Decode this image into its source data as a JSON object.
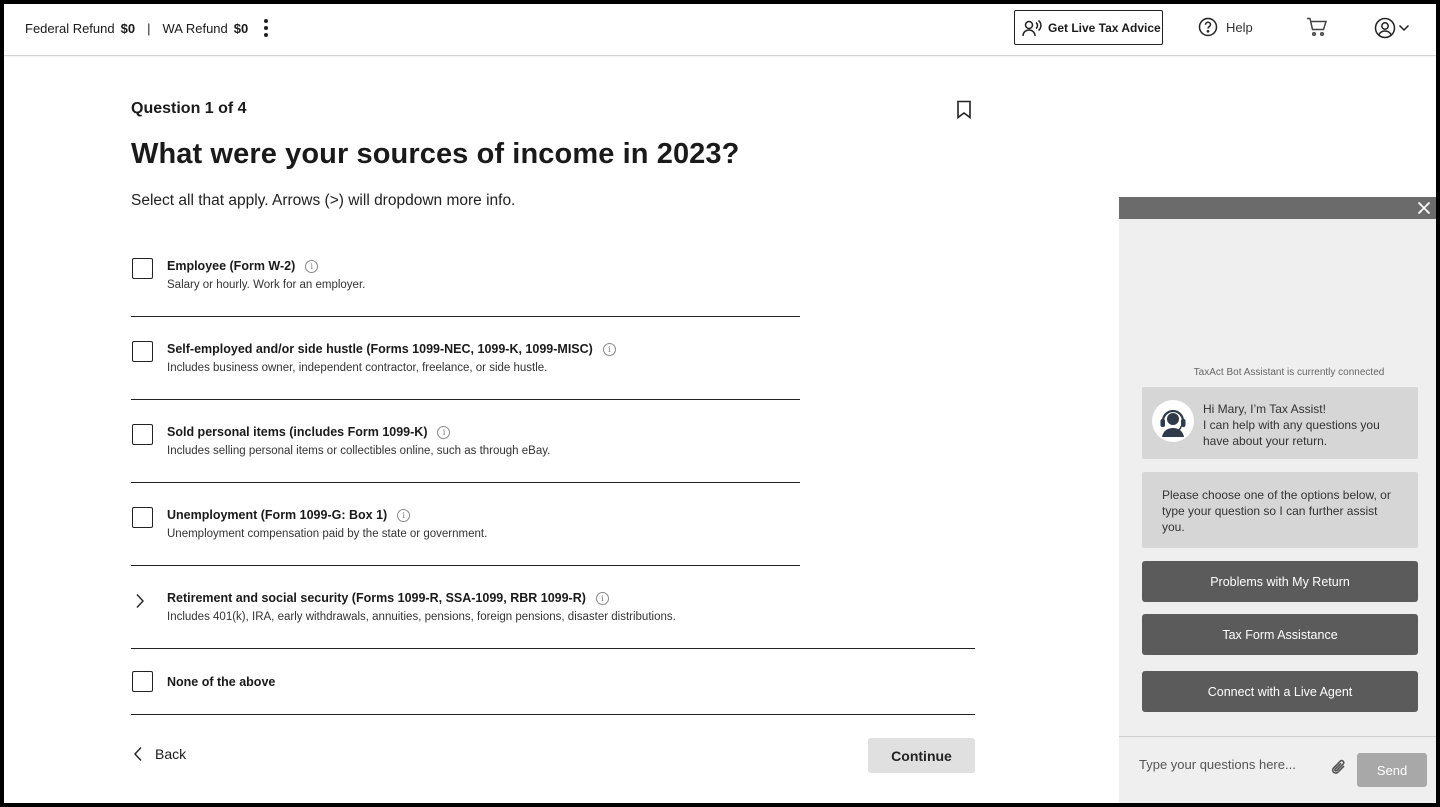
{
  "header": {
    "federal_label": "Federal Refund",
    "federal_amount": "$0",
    "separator": "|",
    "state_label": "WA Refund",
    "state_amount": "$0",
    "live_advice_label": "Get Live Tax Advice",
    "help_label": "Help",
    "icons": [
      "kebab-menu-icon",
      "headset-person-icon",
      "help-circle-icon",
      "cart-icon",
      "account-icon",
      "chevron-down-icon"
    ]
  },
  "question": {
    "counter": "Question 1 of 4",
    "title": "What were your sources of income in 2023?",
    "subtitle": "Select all that apply. Arrows (>)  will dropdown more info."
  },
  "options": [
    {
      "title": "Employee (Form W-2)",
      "desc": "Salary or hourly. Work for an employer.",
      "control": "checkbox",
      "checked": false
    },
    {
      "title": "Self-employed and/or side hustle (Forms 1099-NEC, 1099-K, 1099-MISC)",
      "desc": "Includes business owner, independent contractor, freelance, or side hustle.",
      "control": "checkbox",
      "checked": false
    },
    {
      "title": "Sold personal items (includes Form 1099-K)",
      "desc": "Includes selling personal items or collectibles online, such as through eBay.",
      "control": "checkbox",
      "checked": false
    },
    {
      "title": "Unemployment (Form 1099-G: Box 1)",
      "desc": "Unemployment compensation paid by the state or government.",
      "control": "checkbox",
      "checked": false
    },
    {
      "title": "Retirement and social security (Forms 1099-R, SSA-1099, RBR 1099-R)",
      "desc": "Includes 401(k), IRA, early withdrawals, annuities, pensions, foreign pensions, disaster distributions.",
      "control": "expand-chevron"
    },
    {
      "title": "None of the above",
      "control": "checkbox",
      "checked": false
    }
  ],
  "footer": {
    "back_label": "Back",
    "continue_label": "Continue"
  },
  "chat": {
    "status": "TaxAct Bot Assistant is currently connected",
    "greeting_lines": [
      "Hi Mary, I’m Tax Assist!",
      "I can help with any questions you have about your return."
    ],
    "prompt": "Please choose one of the options below, or type your question so I can further assist you.",
    "buttons": [
      "Problems with My Return",
      "Tax Form Assistance",
      "Connect with a Live Agent"
    ],
    "input_placeholder": "Type your questions here...",
    "input_value": "",
    "send_label": "Send",
    "colors": {
      "bar": "#6b6b6b",
      "panel": "#efefef",
      "bubble": "#d6d6d6",
      "button": "#5b5b5b",
      "send": "#a8a8a8"
    }
  }
}
